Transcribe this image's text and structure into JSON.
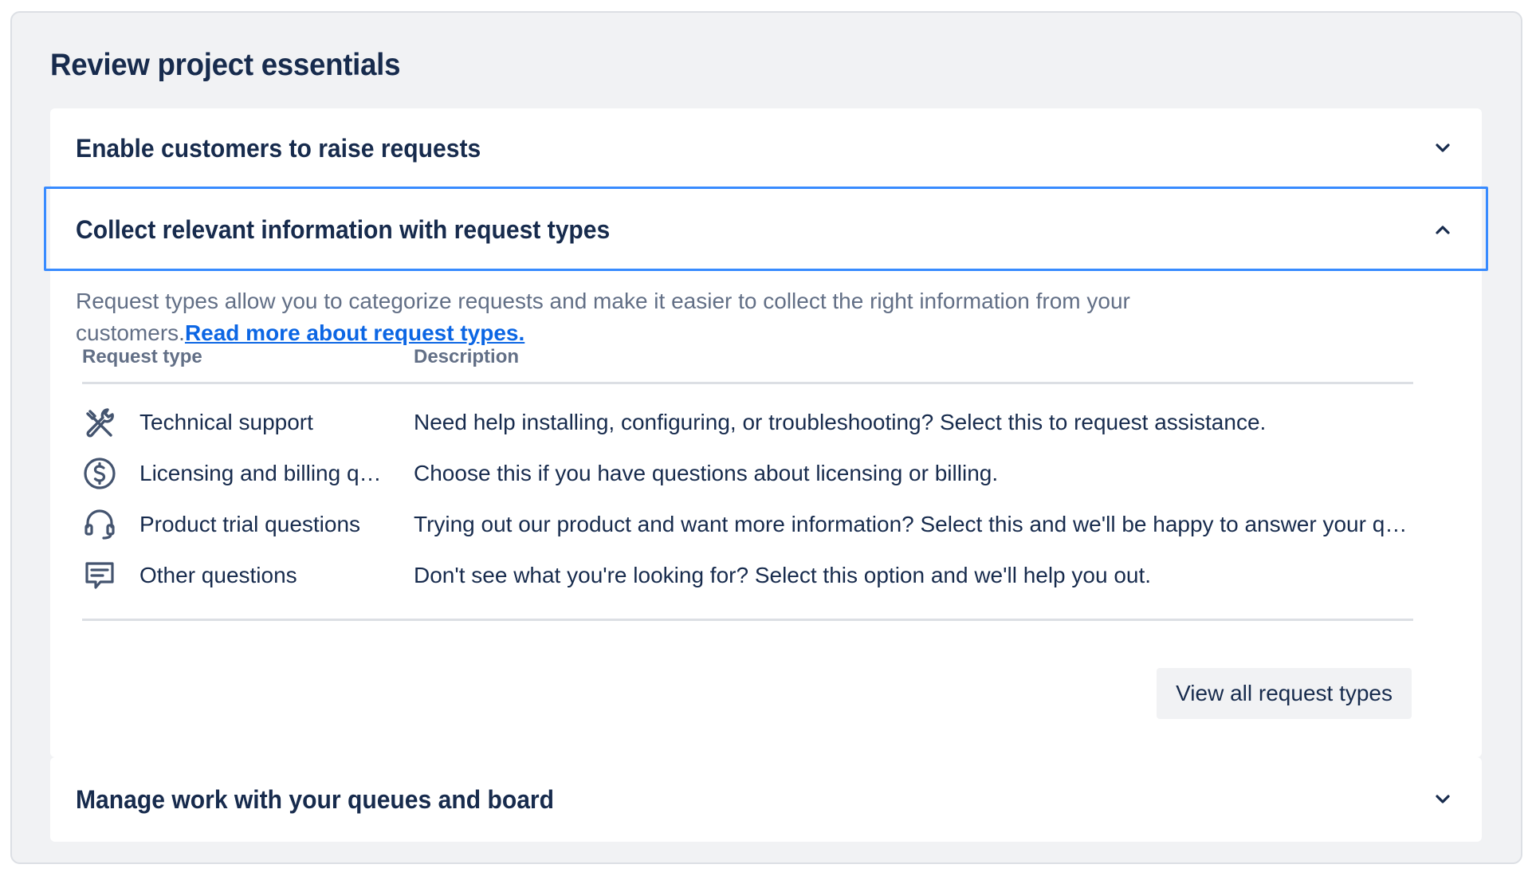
{
  "page": {
    "title": "Review project essentials"
  },
  "sections": [
    {
      "title": "Enable customers to raise requests",
      "expanded": false
    },
    {
      "title": "Collect relevant information with request types",
      "expanded": true,
      "intro_text": "Request types allow you to categorize requests and make it easier to collect the right information from your customers.",
      "intro_link": "Read more about request types.",
      "table": {
        "columns": [
          "Request type",
          "Description"
        ],
        "rows": [
          {
            "icon": "tools-icon",
            "name": "Technical support",
            "description": "Need help installing, configuring, or troubleshooting? Select this to request assistance."
          },
          {
            "icon": "dollar-circle-icon",
            "name": "Licensing and billing questions",
            "description": "Choose this if you have questions about licensing or billing."
          },
          {
            "icon": "headset-icon",
            "name": "Product trial questions",
            "description": "Trying out our product and want more information? Select this and we'll be happy to answer your questions."
          },
          {
            "icon": "comment-icon",
            "name": "Other questions",
            "description": "Don't see what you're looking for? Select this option and we'll help you out."
          }
        ]
      },
      "button_label": "View all request types"
    },
    {
      "title": "Manage work with your queues and board",
      "expanded": false
    }
  ]
}
